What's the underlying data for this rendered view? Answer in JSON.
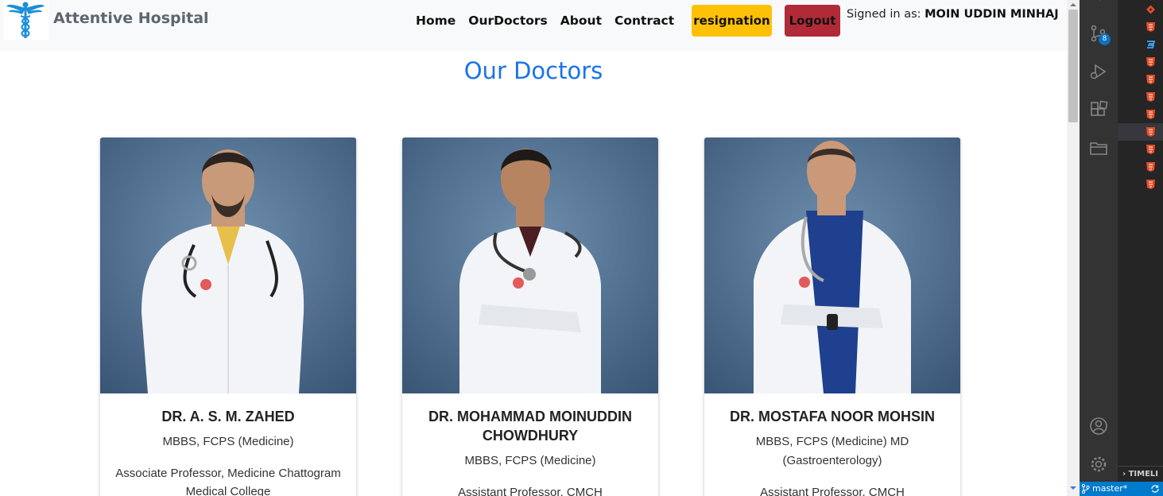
{
  "navbar": {
    "brand": "Attentive Hospital",
    "links": [
      "Home",
      "OurDoctors",
      "About",
      "Contract"
    ],
    "resign_label": "resignation",
    "logout_label": "Logout",
    "signed_prefix": "Signed in as: ",
    "user_name": "MOIN UDDIN MINHAJ"
  },
  "main": {
    "title": "Our Doctors",
    "doctors": [
      {
        "name": "DR. A. S. M. ZAHED",
        "degree": "MBBS, FCPS (Medicine)",
        "position": "Associate Professor, Medicine Chattogram Medical College"
      },
      {
        "name": "DR. MOHAMMAD MOINUDDIN CHOWDHURY",
        "degree": "MBBS, FCPS (Medicine)",
        "position": "Assistant Professor, CMCH"
      },
      {
        "name": "DR. MOSTAFA NOOR MOHSIN",
        "degree": "MBBS, FCPS (Medicine) MD (Gastroenterology)",
        "position": "Assistant Professor, CMCH"
      }
    ]
  },
  "vscode": {
    "badge": "8",
    "timeline_label": "TIMELI",
    "branch": "master*"
  },
  "colors": {
    "title_blue": "#1a73e8",
    "resign_yellow": "#ffc107",
    "logout_red": "#b02a37",
    "photo_bg": "#4a6a8a",
    "status_blue": "#007acc"
  }
}
